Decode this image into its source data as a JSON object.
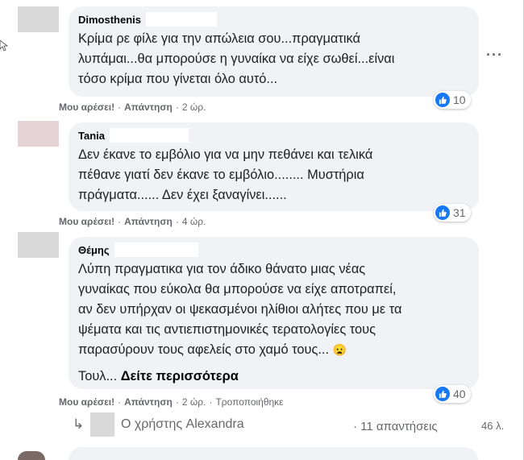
{
  "comments": [
    {
      "author": "Dimosthenis",
      "text": "Κρίμα ρε φίλε για την απώλεια σου...πραγματικά\nλυπάμαι...θα μπορούσε η γυναίκα να είχε σωθεί...είναι\nτόσο κρίμα που γίνεται όλο αυτό...",
      "like_label": "Μου αρέσει!",
      "reply_label": "Απάντηση",
      "time": "2 ώρ.",
      "reactions": "10"
    },
    {
      "author": "Tania",
      "text": "Δεν έκανε το εμβόλιο για να μην πεθάνει και τελικά\nπέθανε γιατί δεν έκανε το εμβόλιο........ Μυστήρια\nπράγματα...... Δεν έχει ξαναγίνει......",
      "like_label": "Μου αρέσει!",
      "reply_label": "Απάντηση",
      "time": "4 ώρ.",
      "reactions": "31"
    },
    {
      "author": "Θέμης",
      "text": "Λύπη πραγματικα για τον άδικο θάνατο μιας νέας\nγυναίκας που εύκολα θα μπορούσε να είχε αποτραπεί,\nαν δεν υπήρχαν οι ψεκασμένοι ηλίθιοι αλήτες που με τα\nψέματα και τις αντιεπιστημονικές τερατολογίες τους\nπαρασύρουν τους αφελείς στο χαμό τους...",
      "emoji": "😦",
      "truncated_prefix": "Τουλ...",
      "see_more": "Δείτε περισσότερα",
      "like_label": "Μου αρέσει!",
      "reply_label": "Απάντηση",
      "time": "2 ώρ.",
      "edited": "Τροποποιήθηκε",
      "reactions": "40"
    }
  ],
  "replies": {
    "arrow": "↳",
    "user_text": "Ο χρήστης Alexandra",
    "count_text": "· 11 απαντήσεις",
    "time": "46 λ."
  },
  "more_options": "···",
  "colors": {
    "bubble": "#f0f2f5",
    "like_blue": "#1877f2",
    "secondary_text": "#65676b"
  }
}
